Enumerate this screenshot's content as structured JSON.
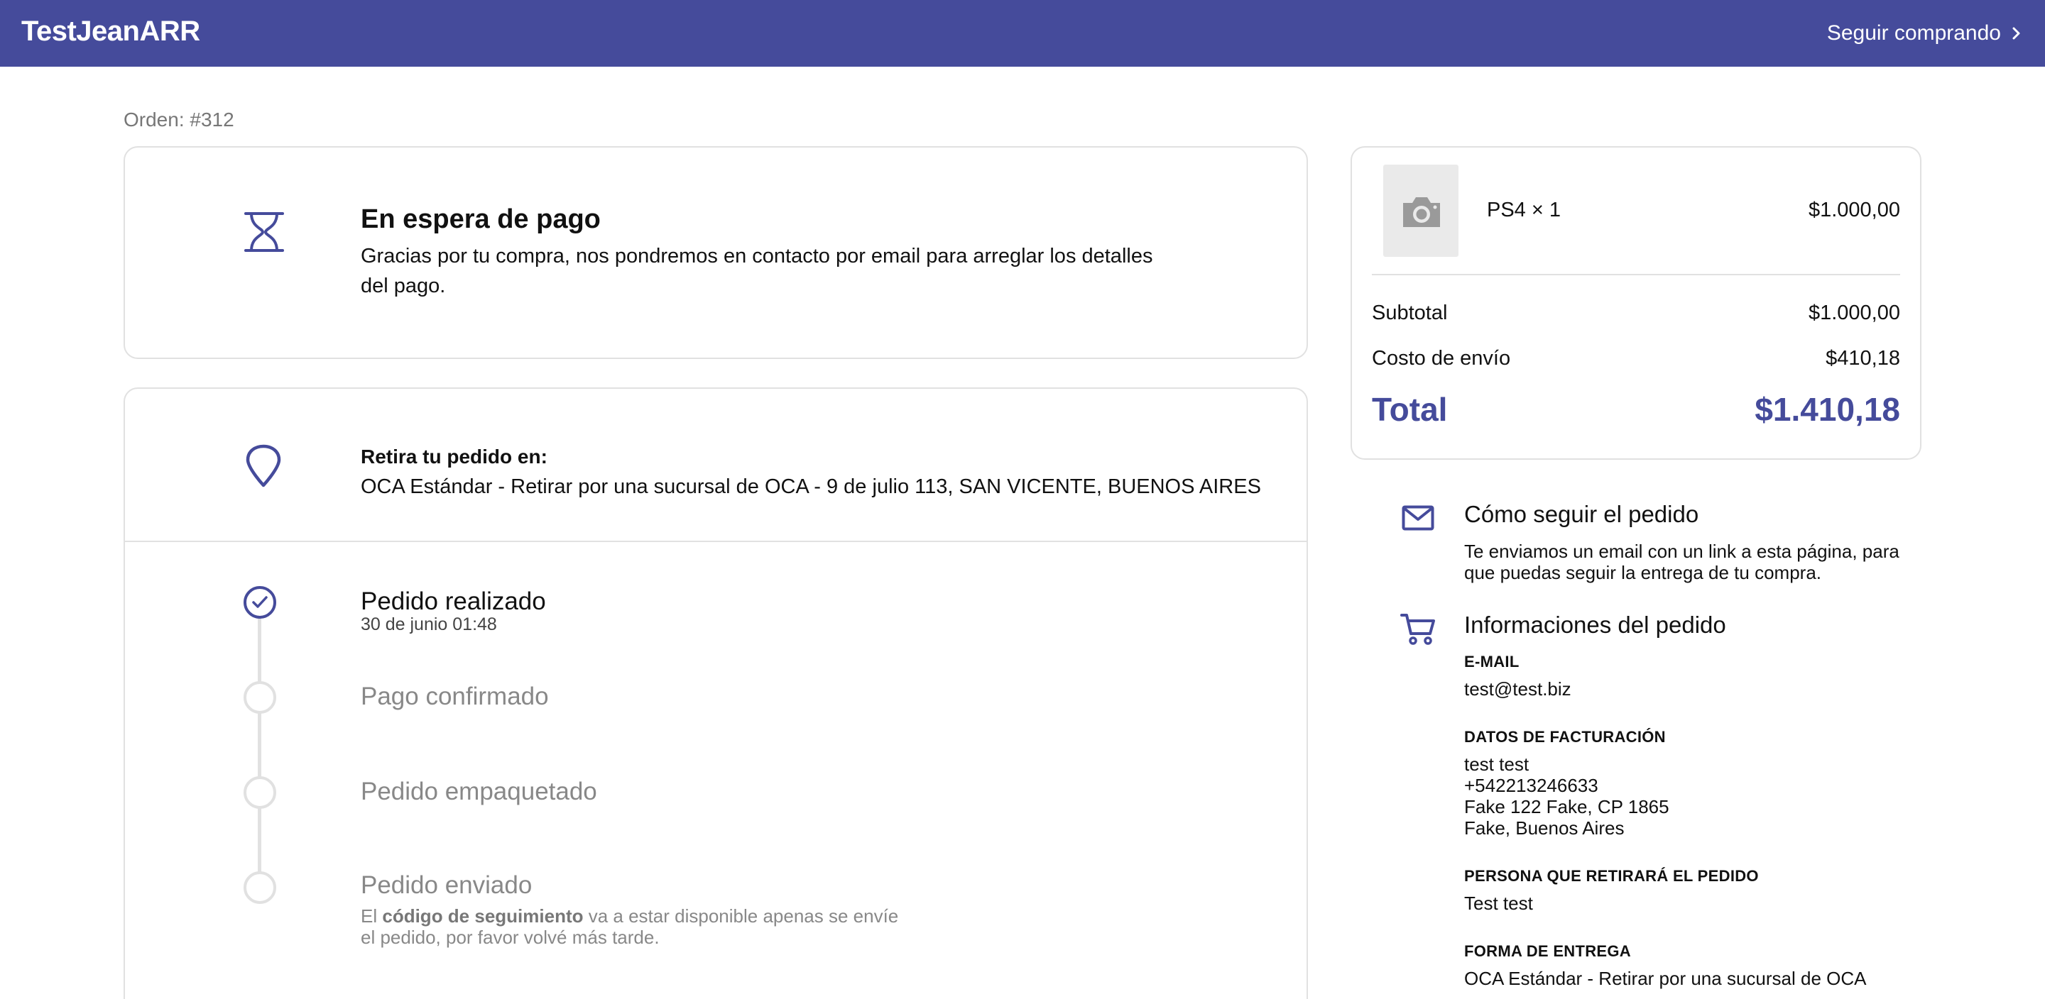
{
  "header": {
    "brand": "TestJeanARR",
    "keep_shopping": "Seguir comprando",
    "keep_shopping_icon": "chevron-right-icon",
    "background_color": "#454b9b"
  },
  "order": {
    "number_label": "Orden: #312"
  },
  "status": {
    "icon": "hourglass-icon",
    "title": "En espera de pago",
    "description": "Gracias por tu compra, nos pondremos en contacto por email para arreglar los detalles del pago."
  },
  "pickup": {
    "icon": "map-pin-icon",
    "label": "Retira tu pedido en:",
    "address": "OCA Estándar - Retirar por una sucursal de OCA - 9 de julio 113, SAN VICENTE, BUENOS AIRES"
  },
  "timeline": {
    "steps": [
      {
        "title": "Pedido realizado",
        "date": "30 de junio 01:48",
        "done": true
      },
      {
        "title": "Pago confirmado",
        "done": false
      },
      {
        "title": "Pedido empaquetado",
        "done": false
      },
      {
        "title": "Pedido enviado",
        "done": false
      }
    ],
    "tracking_note_prefix": "El",
    "tracking_note_bold": "código de seguimiento",
    "tracking_note_suffix": "va a estar disponible apenas se envíe el pedido, por favor volvé más tarde."
  },
  "summary": {
    "product": {
      "thumbnail_icon": "camera-icon",
      "name": "PS4 × 1",
      "price": "$1.000,00"
    },
    "subtotal_label": "Subtotal",
    "subtotal_value": "$1.000,00",
    "shipping_label": "Costo de envío",
    "shipping_value": "$410,18",
    "total_label": "Total",
    "total_value": "$1.410,18",
    "accent_color": "#454b9b"
  },
  "tracking_info": {
    "icon": "envelope-icon",
    "title": "Cómo seguir el pedido",
    "text": "Te enviamos un email con un link a esta página, para que puedas seguir la entrega de tu compra."
  },
  "order_info": {
    "icon": "cart-icon",
    "title": "Informaciones del pedido",
    "email_label": "E-MAIL",
    "email_value": "test@test.biz",
    "billing_label": "DATOS DE FACTURACIÓN",
    "billing_lines": [
      "test test",
      "+542213246633",
      "Fake 122 Fake, CP 1865",
      "Fake, Buenos Aires"
    ],
    "pickup_person_label": "PERSONA QUE RETIRARÁ EL PEDIDO",
    "pickup_person_value": "Test test",
    "delivery_label": "FORMA DE ENTREGA",
    "delivery_value": "OCA Estándar - Retirar por una sucursal de OCA"
  }
}
